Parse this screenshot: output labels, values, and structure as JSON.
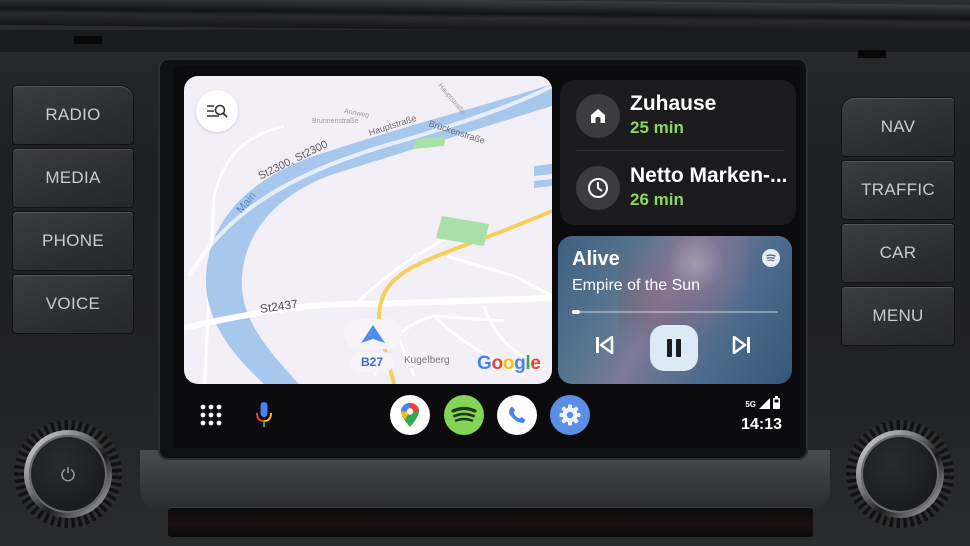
{
  "hardware": {
    "left_buttons": [
      "RADIO",
      "MEDIA",
      "PHONE",
      "VOICE"
    ],
    "right_buttons": [
      "NAV",
      "TRAFFIC",
      "CAR",
      "MENU"
    ]
  },
  "map": {
    "labels": {
      "river": "Main",
      "road_st2300": "St2300, St2300",
      "hauptstrasse": "Hauptstraße",
      "brueckenstrasse": "Brückenstraße",
      "hauptstrasse_north": "Hauptstraße",
      "st2437": "St2437",
      "kugelberg": "Kugelberg",
      "small_street_1": "Annweg",
      "small_street_2": "Brunnenstraße"
    },
    "road_shield": "B27",
    "attribution": "Google",
    "colors": {
      "background": "#f3eff6",
      "water": "#a8c7ec",
      "highway": "#f6cf5a",
      "park": "#a9dfa8",
      "nav_arrow": "#4d8ef0"
    }
  },
  "destinations": [
    {
      "name": "Zuhause",
      "eta": "25 min",
      "icon": "home-icon"
    },
    {
      "name": "Netto Marken-...",
      "eta": "26 min",
      "icon": "history-clock-icon"
    }
  ],
  "media": {
    "title": "Alive",
    "artist": "Empire of the Sun",
    "progress": 0.04,
    "source_icon": "spotify-icon",
    "state": "playing"
  },
  "rail": {
    "apps": [
      {
        "name": "Google Maps",
        "icon": "maps-icon"
      },
      {
        "name": "Spotify",
        "icon": "spotify-icon"
      },
      {
        "name": "Phone",
        "icon": "phone-icon"
      },
      {
        "name": "Settings",
        "icon": "settings-icon"
      }
    ],
    "network": "5G",
    "time": "14:13"
  },
  "colors": {
    "eta_green": "#8fd462",
    "spotify_green": "#84d457",
    "settings_blue": "#5b8ee6"
  }
}
